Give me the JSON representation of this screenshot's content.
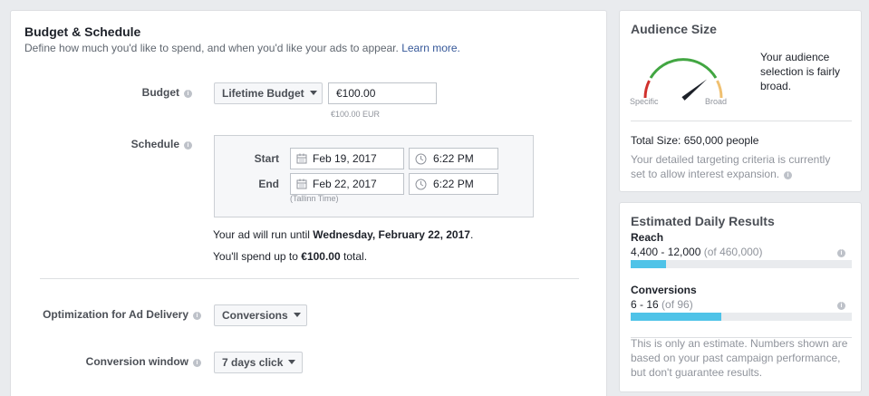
{
  "budget_schedule": {
    "title": "Budget & Schedule",
    "description": "Define how much you'd like to spend, and when you'd like your ads to appear.",
    "learn_more": "Learn more.",
    "budget_label": "Budget",
    "budget_type": "Lifetime Budget",
    "budget_amount": "€100.00",
    "budget_note": "€100.00 EUR",
    "schedule_label": "Schedule",
    "start_label": "Start",
    "start_date": "Feb 19, 2017",
    "start_time": "6:22 PM",
    "end_label": "End",
    "end_date": "Feb 22, 2017",
    "end_time": "6:22 PM",
    "timezone": "(Tallinn Time)",
    "run_until_prefix": "Your ad will run until",
    "run_until_date": "Wednesday, February 22, 2017",
    "run_until_suffix": ".",
    "spend_prefix": "You'll spend up to",
    "spend_amount": "€100.00",
    "spend_suffix": "total.",
    "optimization_label": "Optimization for Ad Delivery",
    "optimization_value": "Conversions",
    "conversion_window_label": "Conversion window",
    "conversion_window_value": "7 days click"
  },
  "audience": {
    "title": "Audience Size",
    "gauge_specific": "Specific",
    "gauge_broad": "Broad",
    "gauge_level": 0.78,
    "summary": "Your audience selection is fairly broad.",
    "summary_lines": [
      "Your audience",
      "selection is fairly",
      "broad."
    ],
    "total_size": "Total Size: 650,000 people",
    "detail": "Your detailed targeting criteria is currently set to allow interest expansion.",
    "detail_lines": [
      "Your detailed targeting criteria is currently",
      "set to allow interest expansion."
    ]
  },
  "estimates": {
    "title": "Estimated Daily Results",
    "reach_label": "Reach",
    "reach_range": "4,400 - 12,000",
    "reach_total": "(of 460,000)",
    "reach_fraction": 0.16,
    "conversions_label": "Conversions",
    "conversions_range": "6 - 16",
    "conversions_total": "(of 96)",
    "conversions_fraction": 0.41,
    "disclaimer_lines": [
      "This is only an estimate. Numbers shown are",
      "based on your past campaign performance,",
      "but don't guarantee results."
    ]
  },
  "colors": {
    "accent_link": "#365899",
    "bar_fill": "#4fc3e8",
    "gauge_red": "#d0312d",
    "gauge_green": "#42a642",
    "gauge_yellow": "#f0c070"
  },
  "icons": {
    "calendar": "calendar-icon",
    "clock": "clock-icon",
    "info": "info-icon",
    "caret": "caret-down-icon"
  }
}
